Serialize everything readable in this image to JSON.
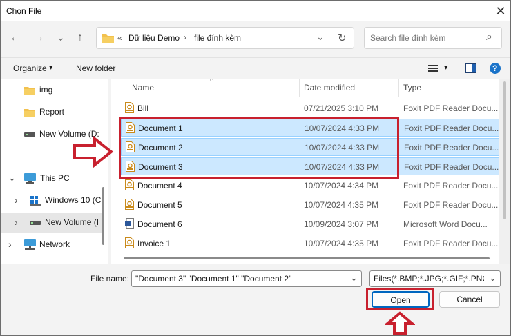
{
  "window": {
    "title": "Chọn File",
    "close_glyph": "✕"
  },
  "nav": {
    "back_glyph": "←",
    "forward_glyph": "→",
    "recent_glyph": "⌄",
    "up_glyph": "↑",
    "chevrons": "«",
    "breadcrumb": [
      "Dữ liệu Demo",
      "file đính kèm"
    ],
    "separator": "›",
    "dropdown_glyph": "⌄",
    "refresh_glyph": "↻",
    "search_placeholder": "Search file đính kèm",
    "search_glyph": "⌕"
  },
  "toolbar": {
    "organize": "Organize",
    "organize_caret": "▾",
    "new_folder": "New folder",
    "view_caret": "▾",
    "help_glyph": "?"
  },
  "sidebar": {
    "items": [
      {
        "label": "img",
        "kind": "folder"
      },
      {
        "label": "Report",
        "kind": "folder"
      },
      {
        "label": "New Volume (D:",
        "kind": "drive"
      },
      {
        "label": "This PC",
        "kind": "pc",
        "chevron": "⌄"
      },
      {
        "label": "Windows 10 (C",
        "kind": "windrive",
        "chevron": "›"
      },
      {
        "label": "New Volume (I",
        "kind": "drive",
        "chevron": "›"
      },
      {
        "label": "Network",
        "kind": "network",
        "chevron": "›"
      }
    ]
  },
  "columns": {
    "name": "Name",
    "date": "Date modified",
    "type": "Type",
    "sort_glyph": "^"
  },
  "files": [
    {
      "name": "Bill",
      "date": "07/21/2025 3:10 PM",
      "type": "Foxit PDF Reader Docu...",
      "icon": "pdf",
      "selected": false
    },
    {
      "name": "Document 1",
      "date": "10/07/2024 4:33 PM",
      "type": "Foxit PDF Reader Docu...",
      "icon": "pdf",
      "selected": true
    },
    {
      "name": "Document 2",
      "date": "10/07/2024 4:33 PM",
      "type": "Foxit PDF Reader Docu...",
      "icon": "pdf",
      "selected": true
    },
    {
      "name": "Document 3",
      "date": "10/07/2024 4:33 PM",
      "type": "Foxit PDF Reader Docu...",
      "icon": "pdf",
      "selected": true
    },
    {
      "name": "Document 4",
      "date": "10/07/2024 4:34 PM",
      "type": "Foxit PDF Reader Docu...",
      "icon": "pdf",
      "selected": false
    },
    {
      "name": "Document 5",
      "date": "10/07/2024 4:35 PM",
      "type": "Foxit PDF Reader Docu...",
      "icon": "pdf",
      "selected": false
    },
    {
      "name": "Document 6",
      "date": "10/09/2024 3:07 PM",
      "type": "Microsoft Word Docu...",
      "icon": "word",
      "selected": false
    },
    {
      "name": "Invoice 1",
      "date": "10/07/2024 4:35 PM",
      "type": "Foxit PDF Reader Docu...",
      "icon": "pdf",
      "selected": false
    }
  ],
  "footer": {
    "file_name_label": "File name:",
    "file_name_value": "\"Document 3\" \"Document 1\" \"Document 2\"",
    "filter_value": "Files(*.BMP;*.JPG;*.GIF;*.PNG;*.",
    "caret": "⌄",
    "open": "Open",
    "cancel": "Cancel"
  },
  "colors": {
    "highlight": "#c8202e",
    "selection": "#cce8ff",
    "folder": "#f2c14e",
    "pdf_icon": "#c98a1b",
    "word_icon": "#2b579a"
  }
}
